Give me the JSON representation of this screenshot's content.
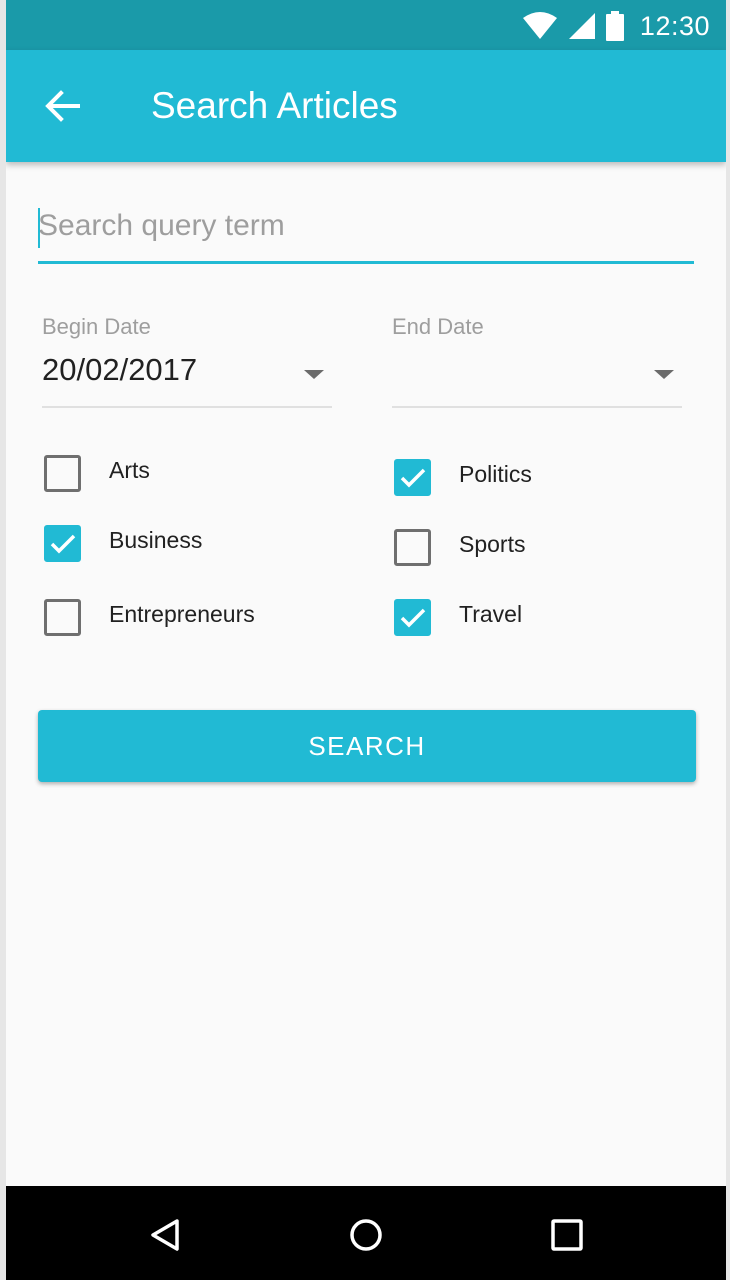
{
  "status_bar": {
    "time": "12:30",
    "icons": [
      "wifi-icon",
      "signal-icon",
      "battery-icon"
    ]
  },
  "app_bar": {
    "title": "Search Articles",
    "back_icon": "arrow-back-icon"
  },
  "search": {
    "value": "",
    "placeholder": "Search query term"
  },
  "dates": {
    "begin": {
      "label": "Begin Date",
      "value": "20/02/2017"
    },
    "end": {
      "label": "End Date",
      "value": ""
    }
  },
  "categories": [
    {
      "label": "Arts",
      "checked": false
    },
    {
      "label": "Politics",
      "checked": true
    },
    {
      "label": "Business",
      "checked": true
    },
    {
      "label": "Sports",
      "checked": false
    },
    {
      "label": "Entrepreneurs",
      "checked": false
    },
    {
      "label": "Travel",
      "checked": true
    }
  ],
  "search_button": {
    "label": "SEARCH"
  },
  "nav_bar": {
    "icons": [
      "back-triangle-icon",
      "home-circle-icon",
      "recents-square-icon"
    ]
  },
  "colors": {
    "accent": "#21bad4",
    "status_bar": "#1a9aa9",
    "background": "#fafafa"
  }
}
